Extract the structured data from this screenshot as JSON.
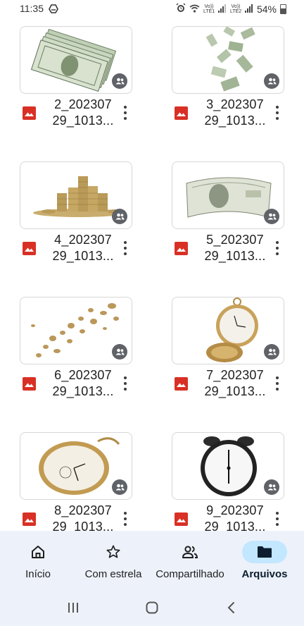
{
  "status_bar": {
    "time": "11:35",
    "sim1": "Vo)) LTE1",
    "sim2": "Vo)) LTE2",
    "battery": "54%",
    "icons": [
      "drive-icon",
      "alarm-icon",
      "wifi-icon",
      "signal-icon",
      "battery-icon"
    ]
  },
  "files": [
    {
      "name_line1": "2_202307",
      "name_line2": "29_1013...",
      "thumb": "money-stack",
      "shared": true
    },
    {
      "name_line1": "3_202307",
      "name_line2": "29_1013...",
      "thumb": "falling-bills",
      "shared": true
    },
    {
      "name_line1": "4_202307",
      "name_line2": "29_1013...",
      "thumb": "coin-piles",
      "shared": true
    },
    {
      "name_line1": "5_202307",
      "name_line2": "29_1013...",
      "thumb": "hundred-dollar-bill",
      "shared": true
    },
    {
      "name_line1": "6_202307",
      "name_line2": "29_1013...",
      "thumb": "flying-coins",
      "shared": true
    },
    {
      "name_line1": "7_202307",
      "name_line2": "29_1013...",
      "thumb": "pocket-watch-open",
      "shared": true
    },
    {
      "name_line1": "8_202307",
      "name_line2": "29_1013...",
      "thumb": "pocket-watch-gold",
      "shared": true
    },
    {
      "name_line1": "9_202307",
      "name_line2": "29_1013...",
      "thumb": "alarm-clock",
      "shared": true
    }
  ],
  "bottom_nav": {
    "items": [
      {
        "label": "Início",
        "icon": "home-icon",
        "active": false
      },
      {
        "label": "Com estrela",
        "icon": "star-icon",
        "active": false
      },
      {
        "label": "Compartilhado",
        "icon": "people-icon",
        "active": false
      },
      {
        "label": "Arquivos",
        "icon": "folder-icon",
        "active": true
      }
    ]
  },
  "colors": {
    "image_icon": "#d93025",
    "nav_background": "#edf2fa",
    "nav_active_pill": "#c2e7ff",
    "badge": "#5f6368"
  }
}
